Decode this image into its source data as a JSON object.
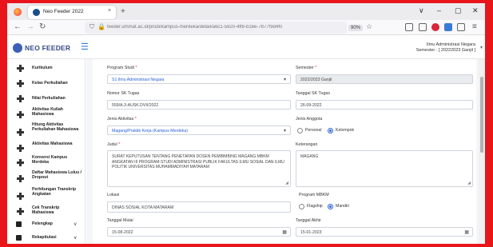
{
  "browser": {
    "tab_title": "Neo Feeder 2022",
    "tab_close": "×",
    "new_tab": "+",
    "url": "feeder.ummat.ac.id/prodi/kampus-merdeka/detail/a6c1-5820-4ff8-b16e-7877f9d4f0",
    "zoom": "90%",
    "window_controls": [
      "∨",
      "–",
      "▢",
      "✕"
    ]
  },
  "app": {
    "logo_text": "NEO FEEDER",
    "user_name": "Ilmu Administrasi Negara",
    "user_semester": "Semester : [ 20222023 Ganjil ]"
  },
  "sidebar": {
    "items": [
      {
        "label": "Kurikulum"
      },
      {
        "label": "Kelas Perkuliahan"
      },
      {
        "label": "Nilai Perkuliahan"
      },
      {
        "label": "Aktivitas Kuliah Mahasiswa"
      },
      {
        "label": "Hitung Aktivitas Perkuliahan Mahasiswa"
      },
      {
        "label": "Aktivitas Mahasiswa"
      },
      {
        "label": "Konversi Kampus Merdeka"
      },
      {
        "label": "Daftar Mahasiswa Lulus / Dropout"
      },
      {
        "label": "Perhitungan Transkrip Angkatan"
      },
      {
        "label": "Cek Transkrip Mahasiswa"
      }
    ],
    "groups": [
      {
        "label": "Pelengkap"
      },
      {
        "label": "Rekapitulasi"
      }
    ]
  },
  "form": {
    "program_studi": {
      "label": "Program Studi",
      "value": "S1 Ilmu Administrasi Negara"
    },
    "semester": {
      "label": "Semester",
      "value": "2022/2023 Ganjil"
    },
    "nomor_sk": {
      "label": "Nomor SK Tugas",
      "value": "559/A.3-AUSK.DVII/2022"
    },
    "tanggal_sk": {
      "label": "Tanggal SK Tugas",
      "value": "26-09-2022"
    },
    "jenis_aktivitas": {
      "label": "Jenis Aktivitas",
      "value": "Magang/Praktik Kerja (Kampus Merdeka)"
    },
    "jenis_anggota": {
      "label": "Jenis Anggota",
      "options": [
        "Personal",
        "Kelompok"
      ],
      "selected": "Kelompok"
    },
    "judul": {
      "label": "Judul",
      "value": "SURAT KEPUTUSAN TENTANG PENETAPAN DOSEN PEMBIMBING MAGANG MBKM ANGKATAN III PROGRAM STUDI ADMINISTRASI PUBLIK FAKULTAS ILMU SOSIAL DAN ILMU POLITIK UNIVERSITAS MUHAMMADIYAH MATARAM"
    },
    "keterangan": {
      "label": "Keterangan",
      "value": "MAGANG"
    },
    "lokasi": {
      "label": "Lokasi",
      "value": "DINAS SOSIAL KOTA MATARAM"
    },
    "program_mbkm": {
      "label": "Program MBKM",
      "options": [
        "Flagship",
        "Mandiri"
      ],
      "selected": "Mandiri"
    },
    "tanggal_mulai": {
      "label": "Tanggal Mulai",
      "value": "15-08-2022"
    },
    "tanggal_akhir": {
      "label": "Tanggal Akhir",
      "value": "15-01-2023"
    }
  },
  "colors": {
    "accent": "#2a62d8",
    "required": "#e02424",
    "border_frame": "#e8151b"
  }
}
